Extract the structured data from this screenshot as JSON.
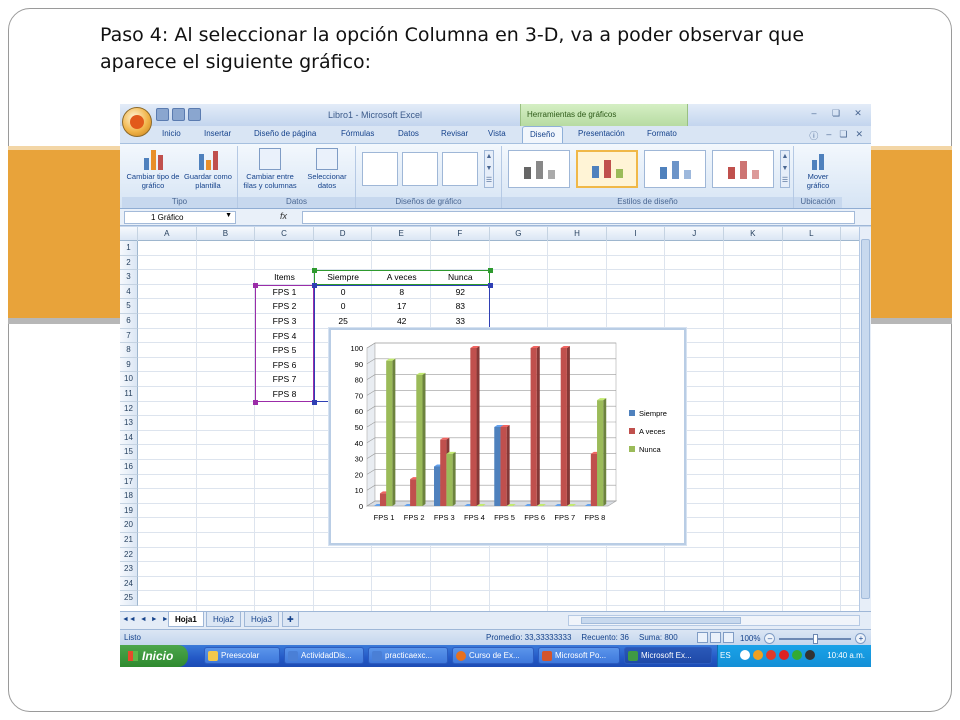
{
  "slide": {
    "instruction": "Paso 4: Al seleccionar la opción Columna en 3-D, va a poder observar que aparece  el siguiente gráfico:"
  },
  "excel": {
    "window_title": "Libro1 - Microsoft Excel",
    "context_tab": "Herramientas de gráficos",
    "ribbon_tabs": [
      "Inicio",
      "Insertar",
      "Diseño de página",
      "Fórmulas",
      "Datos",
      "Revisar",
      "Vista",
      "Diseño",
      "Presentación",
      "Formato"
    ],
    "active_tab": "Diseño",
    "groups": {
      "tipo": {
        "label": "Tipo",
        "btn1": "Cambiar tipo de gráfico",
        "btn2": "Guardar como plantilla"
      },
      "datos": {
        "label": "Datos",
        "btn1": "Cambiar entre filas y columnas",
        "btn2": "Seleccionar datos"
      },
      "disenos": {
        "label": "Diseños de gráfico"
      },
      "estilos": {
        "label": "Estilos de diseño"
      },
      "ubicacion": {
        "label": "Ubicación",
        "btn1": "Mover gráfico"
      }
    },
    "name_box": "1 Gráfico",
    "fx_label": "fx",
    "columns": [
      "A",
      "B",
      "C",
      "D",
      "E",
      "F",
      "G",
      "H",
      "I",
      "J",
      "K",
      "L"
    ],
    "rows": [
      "1",
      "2",
      "3",
      "4",
      "5",
      "6",
      "7",
      "8",
      "9",
      "10",
      "11",
      "12",
      "13",
      "14",
      "15",
      "16",
      "17",
      "18",
      "19",
      "20",
      "21",
      "22",
      "23",
      "24",
      "25"
    ],
    "table": {
      "headers": [
        "Items",
        "Siempre",
        "A veces",
        "Nunca"
      ],
      "rows": [
        [
          "FPS 1",
          "0",
          "8",
          "92"
        ],
        [
          "FPS 2",
          "0",
          "17",
          "83"
        ],
        [
          "FPS 3",
          "25",
          "42",
          "33"
        ],
        [
          "FPS 4",
          "",
          "",
          ""
        ],
        [
          "FPS 5",
          "",
          "",
          ""
        ],
        [
          "FPS 6",
          "",
          "",
          ""
        ],
        [
          "FPS 7",
          "",
          "",
          ""
        ],
        [
          "FPS 8",
          "",
          "",
          ""
        ]
      ]
    },
    "sheet_tabs": [
      "Hoja1",
      "Hoja2",
      "Hoja3"
    ],
    "active_sheet": "Hoja1",
    "status": {
      "ready": "Listo",
      "average": "Promedio: 33,33333333",
      "count": "Recuento: 36",
      "sum": "Suma: 800",
      "zoom": "100%"
    },
    "taskbar": {
      "start": "Inicio",
      "items": [
        "Preescolar",
        "ActividadDis...",
        "practicaexc...",
        "Curso de Ex...",
        "Microsoft Po...",
        "Microsoft Ex..."
      ],
      "language": "ES",
      "clock": "10:40 a.m."
    }
  },
  "colors": {
    "siempre": "#4f81bd",
    "a_veces": "#c0504d",
    "nunca": "#9bbb59",
    "accent_band": "#e8a33a"
  },
  "chart_data": {
    "type": "bar",
    "style": "3d-clustered-column",
    "categories": [
      "FPS 1",
      "FPS 2",
      "FPS 3",
      "FPS 4",
      "FPS 5",
      "FPS 6",
      "FPS 7",
      "FPS 8"
    ],
    "series": [
      {
        "name": "Siempre",
        "values": [
          0,
          0,
          25,
          0,
          50,
          0,
          0,
          0
        ]
      },
      {
        "name": "A veces",
        "values": [
          8,
          17,
          42,
          100,
          50,
          100,
          100,
          33
        ]
      },
      {
        "name": "Nunca",
        "values": [
          92,
          83,
          33,
          0,
          0,
          0,
          0,
          67
        ]
      }
    ],
    "ylim": [
      0,
      100
    ],
    "yticks": [
      0,
      10,
      20,
      30,
      40,
      50,
      60,
      70,
      80,
      90,
      100
    ],
    "grid": true,
    "legend": "right"
  }
}
